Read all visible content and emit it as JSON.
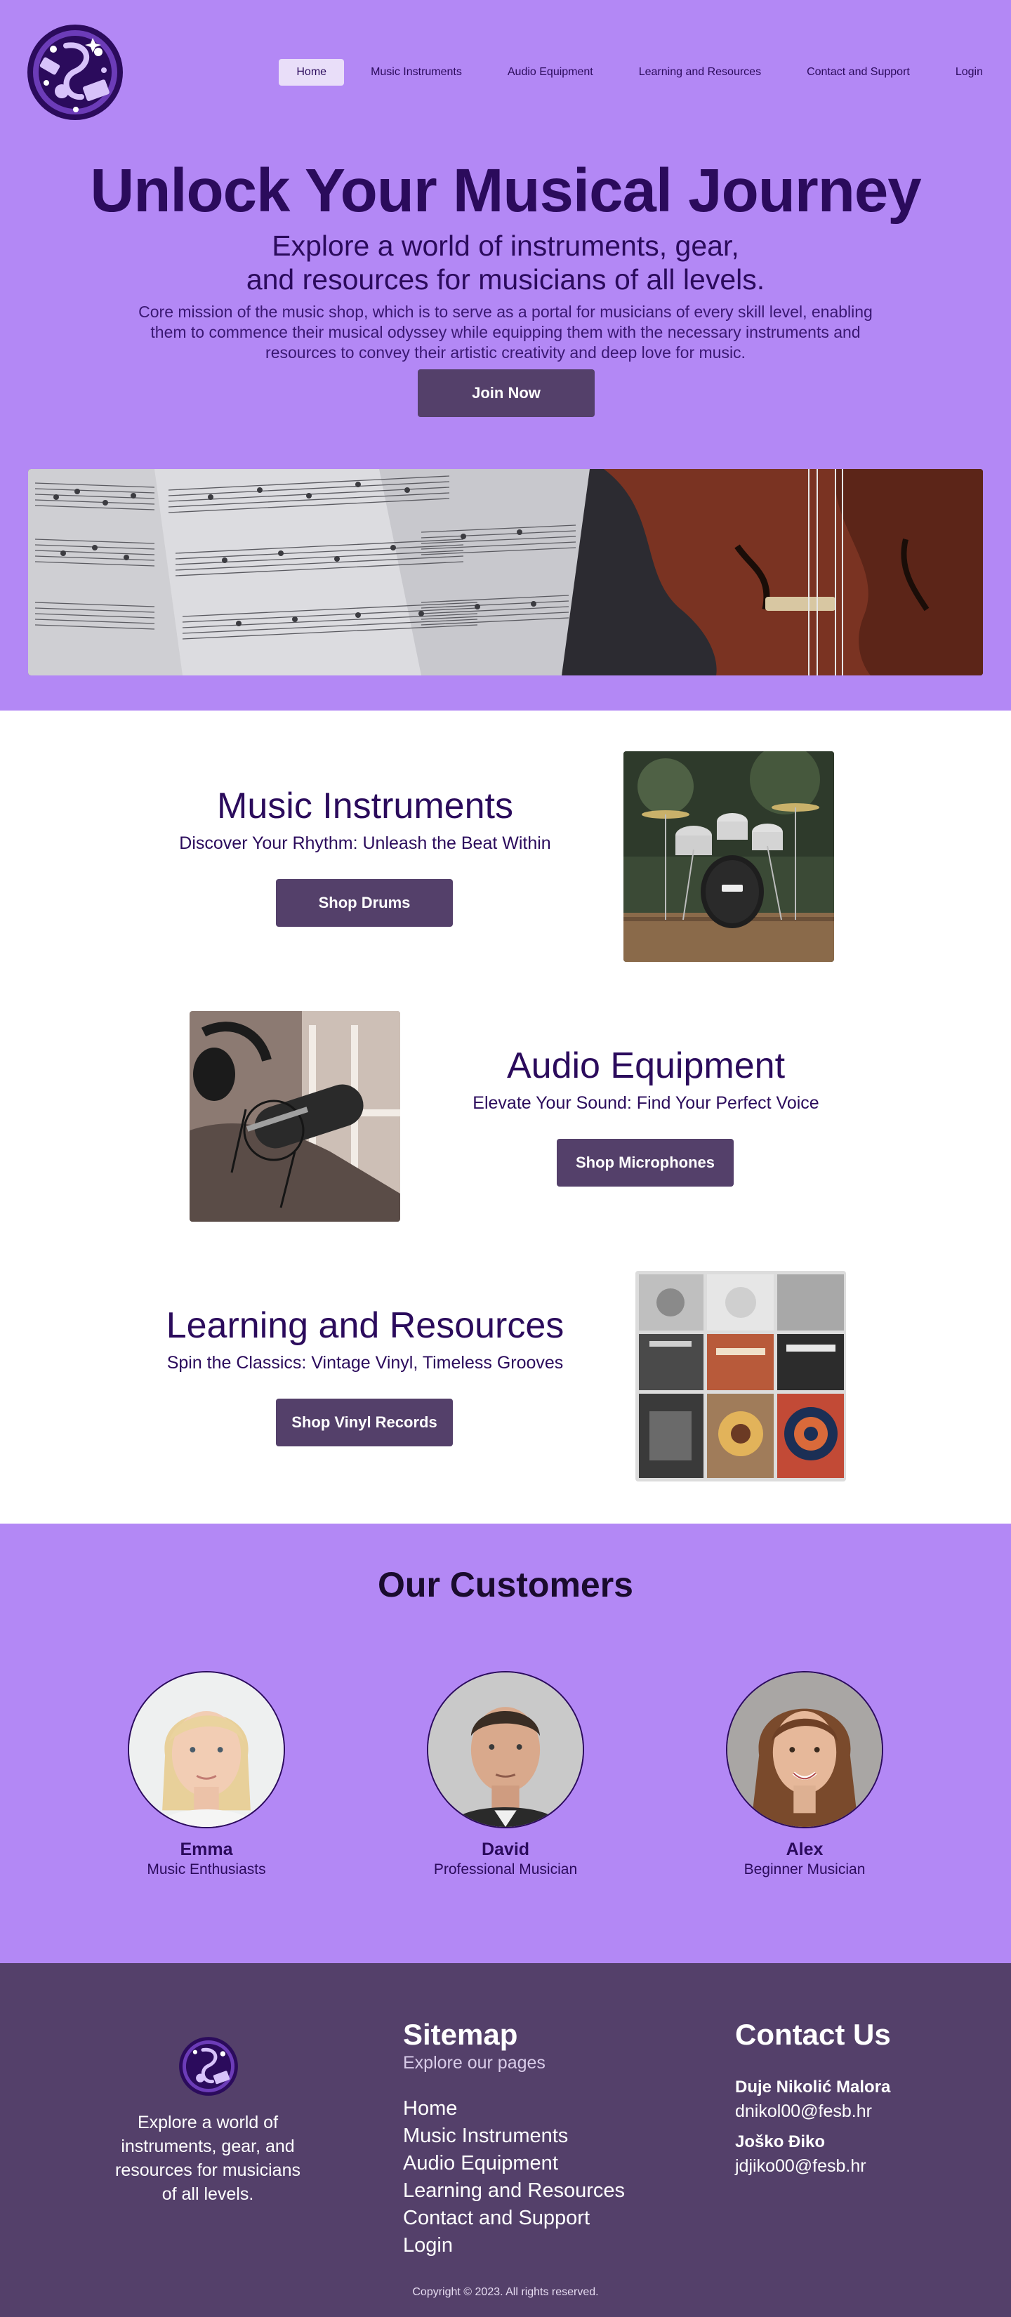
{
  "nav": {
    "items": [
      {
        "label": "Home"
      },
      {
        "label": "Music Instruments"
      },
      {
        "label": "Audio Equipment"
      },
      {
        "label": "Learning and Resources"
      },
      {
        "label": "Contact and Support"
      },
      {
        "label": "Login"
      }
    ],
    "active": "Home"
  },
  "hero": {
    "title": "Unlock Your Musical Journey",
    "subtitle_line1": "Explore a world of instruments, gear,",
    "subtitle_line2": "and resources for musicians of all levels.",
    "description": "Core mission of the music shop, which is to serve as a portal for musicians of every skill level, enabling them to commence their musical odyssey while equipping them with the necessary instruments and resources to convey their artistic creativity and deep love for music.",
    "cta": "Join Now"
  },
  "products": [
    {
      "title": "Music Instruments",
      "subtitle": "Discover Your Rhythm: Unleash the Beat Within",
      "button": "Shop Drums"
    },
    {
      "title": "Audio Equipment",
      "subtitle": "Elevate Your Sound: Find Your Perfect Voice",
      "button": "Shop Microphones"
    },
    {
      "title": "Learning and Resources",
      "subtitle": "Spin the Classics: Vintage Vinyl, Timeless Grooves",
      "button": "Shop Vinyl Records"
    }
  ],
  "customers": {
    "heading": "Our Customers",
    "items": [
      {
        "name": "Emma",
        "role": "Music Enthusiasts"
      },
      {
        "name": "David",
        "role": "Professional Musician"
      },
      {
        "name": "Alex",
        "role": "Beginner Musician"
      }
    ]
  },
  "footer": {
    "tagline": "Explore a world of instruments, gear, and resources for musicians of all levels.",
    "sitemap_title": "Sitemap",
    "sitemap_sub": "Explore our pages",
    "links": [
      "Home",
      "Music Instruments",
      "Audio Equipment",
      "Learning and Resources",
      "Contact and Support",
      "Login"
    ],
    "contact_title": "Contact Us",
    "contacts": [
      {
        "name": "Duje Nikolić Malora",
        "email": "dnikol00@fesb.hr"
      },
      {
        "name": "Joško Điko",
        "email": "jdjiko00@fesb.hr"
      }
    ],
    "copyright": "Copyright © 2023. All rights reserved."
  },
  "colors": {
    "primary_purple": "#b388f5",
    "dark_purple": "#54406a",
    "text_purple": "#2b0b5c",
    "nav_active": "#e9def9"
  },
  "icons": [
    "music-logo-icon"
  ]
}
